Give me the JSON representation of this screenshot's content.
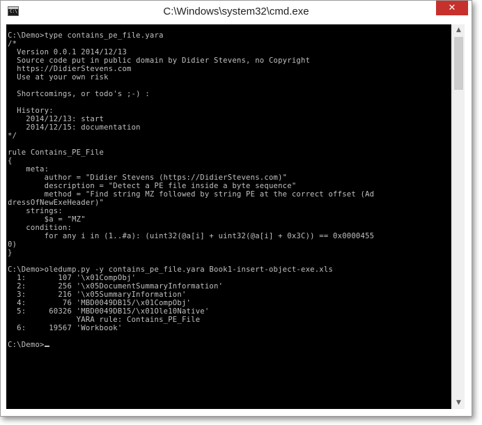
{
  "window": {
    "title": "C:\\Windows\\system32\\cmd.exe",
    "icon": "cmd-icon",
    "close_glyph": "✕"
  },
  "console": {
    "lines": [
      "C:\\Demo>type contains_pe_file.yara",
      "/*",
      "  Version 0.0.1 2014/12/13",
      "  Source code put in public domain by Didier Stevens, no Copyright",
      "  https://DidierStevens.com",
      "  Use at your own risk",
      "",
      "  Shortcomings, or todo's ;-) :",
      "",
      "  History:",
      "    2014/12/13: start",
      "    2014/12/15: documentation",
      "*/",
      "",
      "rule Contains_PE_File",
      "{",
      "    meta:",
      "        author = \"Didier Stevens (https://DidierStevens.com)\"",
      "        description = \"Detect a PE file inside a byte sequence\"",
      "        method = \"Find string MZ followed by string PE at the correct offset (Ad",
      "dressOfNewExeHeader)\"",
      "    strings:",
      "        $a = \"MZ\"",
      "    condition:",
      "        for any i in (1..#a): (uint32(@a[i] + uint32(@a[i] + 0x3C)) == 0x0000455",
      "0)",
      "}",
      "",
      "C:\\Demo>oledump.py -y contains_pe_file.yara Book1-insert-object-exe.xls",
      "  1:       107 '\\x01CompObj'",
      "  2:       256 '\\x05DocumentSummaryInformation'",
      "  3:       216 '\\x05SummaryInformation'",
      "  4:        76 'MBD0049DB15/\\x01CompObj'",
      "  5:     60326 'MBD0049DB15/\\x01Ole10Native'",
      "               YARA rule: Contains_PE_File",
      "  6:     19567 'Workbook'",
      "",
      "C:\\Demo>"
    ]
  },
  "scrollbar": {
    "up_glyph": "▲",
    "down_glyph": "▼"
  }
}
